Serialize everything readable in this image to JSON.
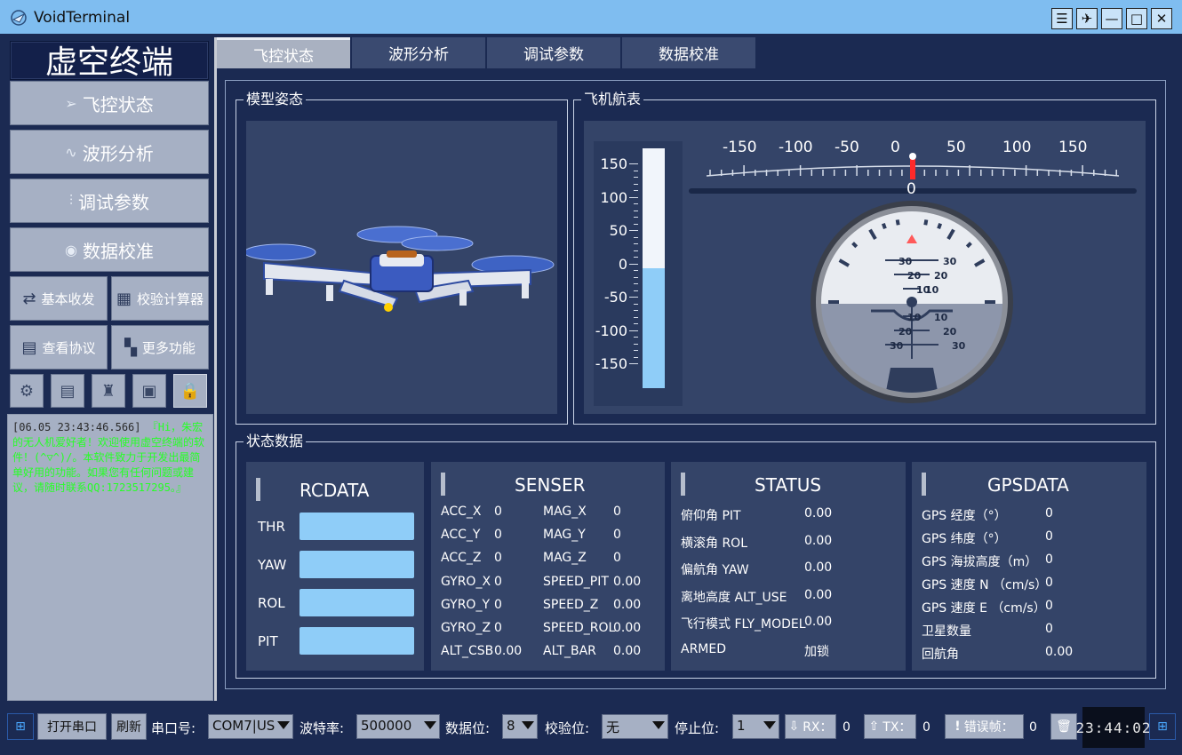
{
  "window": {
    "title": "VoidTerminal",
    "controls": [
      "☰",
      "✈",
      "—",
      "□",
      "✕"
    ]
  },
  "sidebar": {
    "brand": "虚空终端",
    "nav": [
      {
        "label": "飞控状态",
        "icon": "paper-plane-icon"
      },
      {
        "label": "波形分析",
        "icon": "waveform-icon"
      },
      {
        "label": "调试参数",
        "icon": "sliders-icon"
      },
      {
        "label": "数据校准",
        "icon": "target-icon"
      }
    ],
    "tools": [
      {
        "label": "基本收发",
        "icon": "transfer-icon"
      },
      {
        "label": "校验计算器",
        "icon": "calculator-icon"
      },
      {
        "label": "查看协议",
        "icon": "document-icon"
      },
      {
        "label": "更多功能",
        "icon": "grid-icon"
      }
    ],
    "icon_buttons": [
      "gear-icon",
      "notes-icon",
      "shirt-icon",
      "save-icon",
      "lock-icon"
    ],
    "log": {
      "timestamp": "[06.05 23:43:46.566]",
      "message": "『Hi，朱宏的无人机爱好者！欢迎使用虚空终端的软件！(^▽^)/。本软件致力于开发出最简单好用的功能。如果您有任何问题或建议，请随时联系QQ:1723517295。』"
    }
  },
  "tabs": [
    "飞控状态",
    "波形分析",
    "调试参数",
    "数据校准"
  ],
  "active_tab": 0,
  "groups": {
    "model": "模型姿态",
    "instruments": "飞机航表",
    "status_data": "状态数据"
  },
  "altimeter": {
    "ticks": [
      "150",
      "100",
      "50",
      "0",
      "-50",
      "-100",
      "-150"
    ],
    "value_percent": 0.5
  },
  "heading": {
    "ticks": [
      "-150",
      "-100",
      "-50",
      "0",
      "50",
      "100",
      "150"
    ],
    "value": "0"
  },
  "horizon": {
    "marks_up": [
      "30",
      "20",
      "10"
    ],
    "marks_down": [
      "10",
      "20",
      "30"
    ]
  },
  "rcdata": {
    "title": "RCDATA",
    "rows": [
      "THR",
      "YAW",
      "ROL",
      "PIT"
    ]
  },
  "senser": {
    "title": "SENSER",
    "left": [
      {
        "k": "ACC_X",
        "v": "0"
      },
      {
        "k": "ACC_Y",
        "v": "0"
      },
      {
        "k": "ACC_Z",
        "v": "0"
      },
      {
        "k": "GYRO_X",
        "v": "0"
      },
      {
        "k": "GYRO_Y",
        "v": "0"
      },
      {
        "k": "GYRO_Z",
        "v": "0"
      },
      {
        "k": "ALT_CSB",
        "v": "0.00"
      }
    ],
    "right": [
      {
        "k": "MAG_X",
        "v": "0"
      },
      {
        "k": "MAG_Y",
        "v": "0"
      },
      {
        "k": "MAG_Z",
        "v": "0"
      },
      {
        "k": "SPEED_PIT",
        "v": "0.00"
      },
      {
        "k": "SPEED_Z",
        "v": "0.00"
      },
      {
        "k": "SPEED_ROL",
        "v": "0.00"
      },
      {
        "k": "ALT_BAR",
        "v": "0.00"
      }
    ]
  },
  "status": {
    "title": "STATUS",
    "rows": [
      {
        "k": "俯仰角 PIT",
        "v": "0.00"
      },
      {
        "k": "横滚角 ROL",
        "v": "0.00"
      },
      {
        "k": "偏航角 YAW",
        "v": "0.00"
      },
      {
        "k": "离地高度 ALT_USE",
        "v": "0.00"
      },
      {
        "k": "飞行模式 FLY_MODEL",
        "v": "0.00"
      },
      {
        "k": "ARMED",
        "v": "加锁"
      }
    ]
  },
  "gpsdata": {
    "title": "GPSDATA",
    "rows": [
      {
        "k": "GPS 经度（°）",
        "v": "0"
      },
      {
        "k": "GPS 纬度（°）",
        "v": "0"
      },
      {
        "k": "GPS 海拔高度（m）",
        "v": "0"
      },
      {
        "k": "GPS 速度 N （cm/s）",
        "v": "0"
      },
      {
        "k": "GPS 速度 E （cm/s）",
        "v": "0"
      },
      {
        "k": "卫星数量",
        "v": "0"
      },
      {
        "k": "回航角",
        "v": "0.00"
      }
    ]
  },
  "bottom": {
    "open_port": "打开串口",
    "refresh": "刷新",
    "port_label": "串口号:",
    "port_value": "COM7|US",
    "baud_label": "波特率:",
    "baud_value": "500000",
    "databits_label": "数据位:",
    "databits_value": "8",
    "parity_label": "校验位:",
    "parity_value": "无",
    "stopbits_label": "停止位:",
    "stopbits_value": "1",
    "rx_label": "RX：",
    "rx_value": "0",
    "tx_label": "TX：",
    "tx_value": "0",
    "err_label": "错误帧：",
    "err_value": "0",
    "clock": "23:44:02"
  }
}
